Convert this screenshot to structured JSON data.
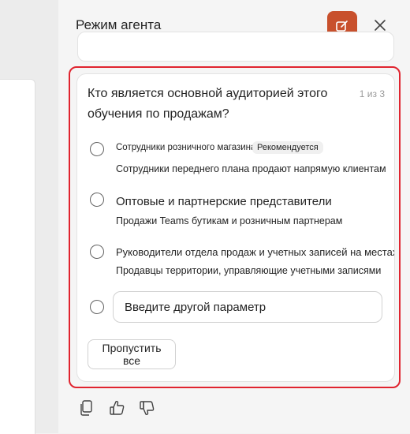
{
  "header": {
    "title": "Режим агента",
    "new_chat_icon": "compose-icon",
    "close_icon": "close-icon",
    "accent": "#c8502c"
  },
  "question_card": {
    "question": "Кто является основной аудиторией этого обучения по продажам?",
    "counter": "1 из 3",
    "options": [
      {
        "title": "Сотрудники розничного магазина",
        "badge": "Рекомендуется",
        "description": "Сотрудники переднего плана продают напрямую клиентам"
      },
      {
        "title": "Оптовые и партнерские представители",
        "description": "Продажи Teams бутикам и розничным партнерам"
      },
      {
        "title": "Руководители отдела продаж и учетных записей на местах",
        "description": "Продавцы территории, управляющие учетными записями"
      }
    ],
    "other_placeholder": "Введите другой параметр",
    "skip_label": "Пропустить все",
    "highlight_color": "#e0242f"
  },
  "feedback": {
    "icons": [
      "copy-icon",
      "thumbs-up-icon",
      "thumbs-down-icon"
    ]
  }
}
